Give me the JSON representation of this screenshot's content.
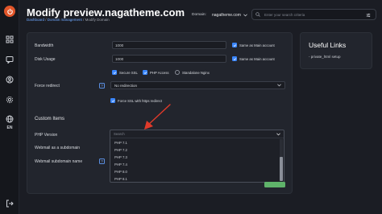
{
  "page": {
    "title": "Modify preview.nagatheme.com",
    "breadcrumbs": [
      "Dashboard",
      "Domain management",
      "Modify Domain"
    ],
    "breadcrumb_sep": " / "
  },
  "header": {
    "domain_label": "Domain:",
    "domain_value": "nagatheme.com",
    "search_placeholder": "Enter your search criteria"
  },
  "sidebar": {
    "language": "EN"
  },
  "form": {
    "bandwidth": {
      "label": "Bandwidth",
      "value": "1000",
      "same_as_main": "Same as Main account"
    },
    "disk_usage": {
      "label": "Disk Usage",
      "value": "1000",
      "same_as_main": "Same as Main account"
    },
    "options": [
      "Secure SSL",
      "PHP Access",
      "Standalone Nginx"
    ],
    "force_redirect": {
      "label": "Force redirect",
      "help": "?",
      "value": "No redirection",
      "https_option": "Force SSL with https redirect"
    },
    "custom_items_title": "Custom Items",
    "php_version": {
      "label": "PHP Version",
      "search_placeholder": "Search",
      "options": [
        "PHP 7.1",
        "PHP 7.2",
        "PHP 7.3",
        "PHP 7.4",
        "PHP 8.0",
        "PHP 8.1"
      ]
    },
    "webmail_subdomain": {
      "label": "Webmail as a subdomain"
    },
    "webmail_subdomain_name": {
      "label": "Webmail subdomain name",
      "help": "?"
    }
  },
  "useful_links": {
    "title": "Useful Links",
    "items": [
      "- private_html setup"
    ]
  },
  "colors": {
    "accent": "#3a86ff",
    "brand": "#e2562a",
    "arrow": "#e03a2a",
    "save": "#5fb36a"
  }
}
